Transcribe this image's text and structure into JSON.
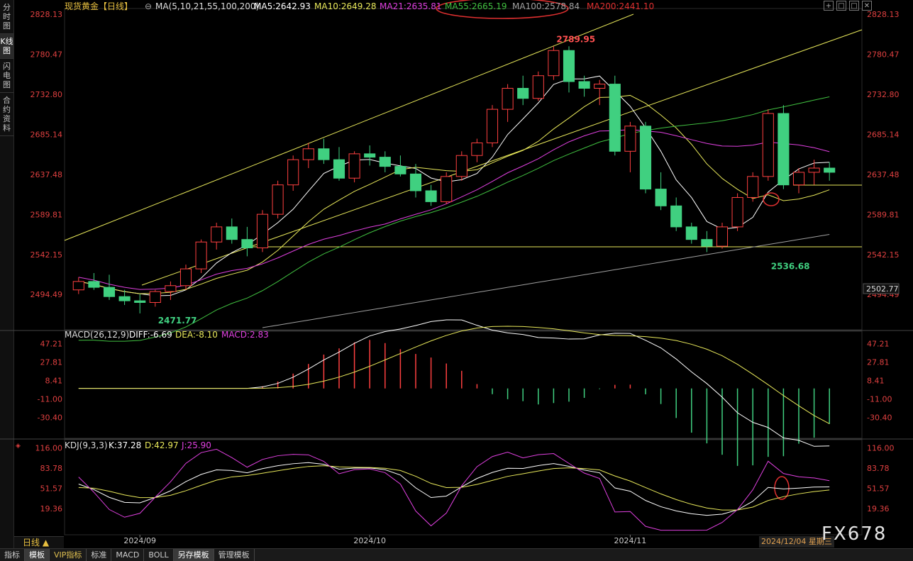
{
  "sidebar": {
    "tabs": [
      {
        "label": "分时图",
        "active": false
      },
      {
        "label": "K线图",
        "active": true
      },
      {
        "label": "闪电图",
        "active": false
      },
      {
        "label": "合约资料",
        "active": false
      }
    ]
  },
  "header": {
    "symbol": "现货黄金",
    "period_tag": "【日线】",
    "ma_params": "MA(5,10,21,55,100,200)",
    "ma_values": [
      {
        "label": "MA5:2642.93",
        "color": "#ffffff"
      },
      {
        "label": "MA10:2649.28",
        "color": "#e8e85a"
      },
      {
        "label": "MA21:2635.81",
        "color": "#e040e0"
      },
      {
        "label": "MA55:2665.19",
        "color": "#40c040"
      },
      {
        "label": "MA100:2578.84",
        "color": "#a0a0a0"
      },
      {
        "label": "MA200:2441.10",
        "color": "#e03030"
      }
    ]
  },
  "window_buttons": [
    "+",
    "□",
    "□",
    "✕"
  ],
  "price_axis": {
    "ticks": [
      "2828.13",
      "2780.47",
      "2732.80",
      "2685.14",
      "2637.48",
      "2589.81",
      "2542.15",
      "2494.49"
    ],
    "tick_values": [
      2828.13,
      2780.47,
      2732.8,
      2685.14,
      2637.48,
      2589.81,
      2542.15,
      2494.49
    ],
    "right_extra": "2502.77",
    "ymin": 2455,
    "ymax": 2835
  },
  "annotations": {
    "high": {
      "label": "2789.95",
      "value": 2789.95,
      "index": 31
    },
    "low_nov": {
      "label": "2536.68",
      "value": 2536.68,
      "index": 45
    },
    "low_sep": {
      "label": "2471.77",
      "value": 2471.77,
      "index": 5
    }
  },
  "macd": {
    "title": "MACD(26,12,9)",
    "diff": "DIFF:-6.69",
    "dea": "DEA:-8.10",
    "macd": "MACD:2.83",
    "ticks": [
      "47.21",
      "27.81",
      "8.41",
      "-11.00",
      "-30.40"
    ],
    "tick_values": [
      47.21,
      27.81,
      8.41,
      -11.0,
      -30.4
    ],
    "ymin": -48,
    "ymax": 52
  },
  "kdj": {
    "title": "KDJ(9,3,3)",
    "k": "K:37.28",
    "d": "D:42.97",
    "j": "J:25.90",
    "ticks": [
      "116.00",
      "83.78",
      "51.57",
      "19.36"
    ],
    "tick_values": [
      116.0,
      83.78,
      51.57,
      19.36
    ],
    "ymin": -20,
    "ymax": 122
  },
  "x_axis_labels": [
    {
      "label": "2024/09",
      "index": 4
    },
    {
      "label": "2024/10",
      "index": 19
    },
    {
      "label": "2024/11",
      "index": 36
    }
  ],
  "crosshair_date": "2024/12/04 星期三",
  "period_button": "日线 ▲",
  "bottom_tabs": [
    {
      "label": "指标",
      "active": false
    },
    {
      "label": "模板",
      "active": true
    },
    {
      "label": "VIP指标",
      "active": false,
      "vip": true
    },
    {
      "label": "标准",
      "active": false
    },
    {
      "label": "MACD",
      "active": false
    },
    {
      "label": "BOLL",
      "active": false
    },
    {
      "label": "另存模板",
      "active": true
    },
    {
      "label": "管理模板",
      "active": false
    }
  ],
  "watermark": "FX678",
  "colors": {
    "up": "#ff4040",
    "down": "#40d080",
    "ma5": "#ffffff",
    "ma10": "#e8e85a",
    "ma21": "#e040e0",
    "ma55": "#40c040",
    "ma100": "#a0a0a0",
    "trend": "#e8e85a",
    "circle": "#e03030"
  },
  "chart_data": {
    "type": "candlestick",
    "title": "现货黄金【日线】",
    "candles": [
      [
        2500,
        2515,
        2495,
        2510
      ],
      [
        2510,
        2520,
        2500,
        2503
      ],
      [
        2503,
        2518,
        2488,
        2492
      ],
      [
        2492,
        2500,
        2482,
        2487
      ],
      [
        2487,
        2495,
        2472,
        2485
      ],
      [
        2485,
        2500,
        2480,
        2498
      ],
      [
        2498,
        2510,
        2488,
        2505
      ],
      [
        2505,
        2530,
        2500,
        2525
      ],
      [
        2525,
        2560,
        2520,
        2557
      ],
      [
        2557,
        2580,
        2548,
        2575
      ],
      [
        2575,
        2585,
        2555,
        2560
      ],
      [
        2560,
        2575,
        2540,
        2550
      ],
      [
        2550,
        2595,
        2545,
        2590
      ],
      [
        2590,
        2630,
        2585,
        2625
      ],
      [
        2625,
        2660,
        2618,
        2655
      ],
      [
        2655,
        2675,
        2645,
        2668
      ],
      [
        2668,
        2680,
        2650,
        2655
      ],
      [
        2655,
        2670,
        2630,
        2633
      ],
      [
        2633,
        2665,
        2628,
        2662
      ],
      [
        2662,
        2672,
        2648,
        2658
      ],
      [
        2658,
        2665,
        2640,
        2647
      ],
      [
        2647,
        2660,
        2635,
        2638
      ],
      [
        2638,
        2650,
        2610,
        2618
      ],
      [
        2618,
        2625,
        2600,
        2605
      ],
      [
        2605,
        2640,
        2602,
        2635
      ],
      [
        2635,
        2665,
        2630,
        2660
      ],
      [
        2660,
        2680,
        2652,
        2675
      ],
      [
        2675,
        2720,
        2670,
        2715
      ],
      [
        2715,
        2745,
        2700,
        2740
      ],
      [
        2740,
        2755,
        2720,
        2728
      ],
      [
        2728,
        2760,
        2725,
        2755
      ],
      [
        2755,
        2790,
        2750,
        2785
      ],
      [
        2785,
        2790,
        2735,
        2748
      ],
      [
        2748,
        2755,
        2730,
        2740
      ],
      [
        2740,
        2750,
        2720,
        2745
      ],
      [
        2745,
        2755,
        2660,
        2665
      ],
      [
        2665,
        2700,
        2640,
        2695
      ],
      [
        2695,
        2700,
        2615,
        2620
      ],
      [
        2620,
        2640,
        2595,
        2600
      ],
      [
        2600,
        2610,
        2570,
        2575
      ],
      [
        2575,
        2580,
        2555,
        2560
      ],
      [
        2560,
        2570,
        2545,
        2552
      ],
      [
        2552,
        2580,
        2549,
        2575
      ],
      [
        2575,
        2615,
        2570,
        2610
      ],
      [
        2610,
        2640,
        2605,
        2635
      ],
      [
        2635,
        2715,
        2630,
        2710
      ],
      [
        2710,
        2720,
        2620,
        2625
      ],
      [
        2625,
        2645,
        2615,
        2640
      ],
      [
        2640,
        2655,
        2625,
        2645
      ],
      [
        2645,
        2652,
        2630,
        2640
      ]
    ],
    "x_categories": [
      "2024/09",
      "2024/10",
      "2024/11"
    ]
  }
}
